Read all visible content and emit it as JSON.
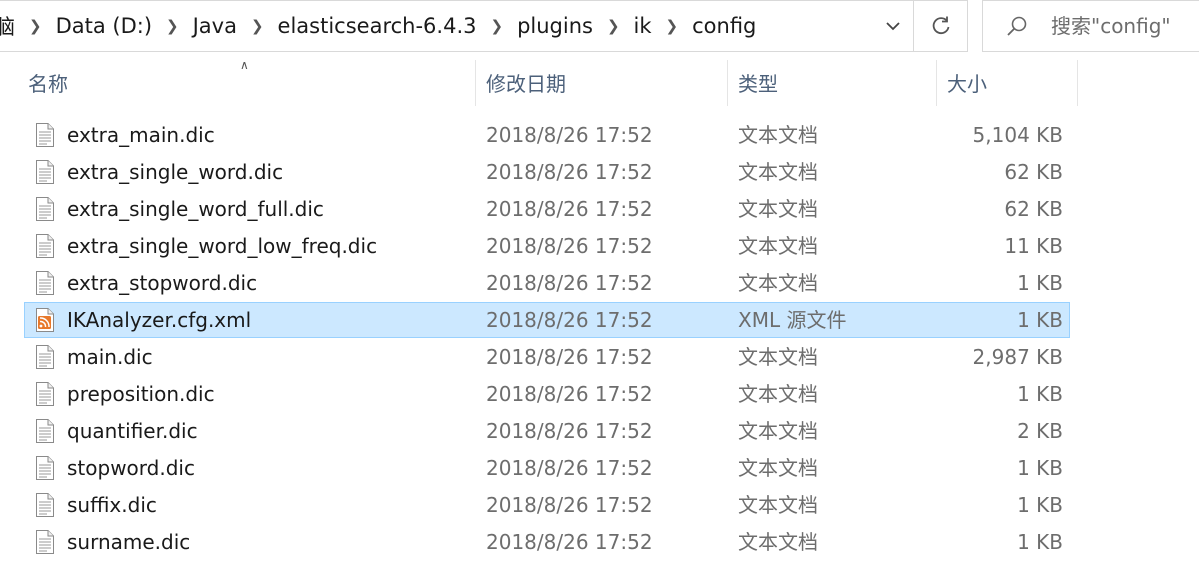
{
  "address": {
    "crumbs": [
      "脑",
      "Data (D:)",
      "Java",
      "elasticsearch-6.4.3",
      "plugins",
      "ik",
      "config"
    ]
  },
  "search": {
    "placeholder": "搜索\"config\""
  },
  "columns": {
    "name": "名称",
    "date": "修改日期",
    "type": "类型",
    "size": "大小"
  },
  "files": [
    {
      "name": "extra_main.dic",
      "date": "2018/8/26 17:52",
      "type": "文本文档",
      "size": "5,104 KB",
      "icon": "text-file-icon",
      "selected": false
    },
    {
      "name": "extra_single_word.dic",
      "date": "2018/8/26 17:52",
      "type": "文本文档",
      "size": "62 KB",
      "icon": "text-file-icon",
      "selected": false
    },
    {
      "name": "extra_single_word_full.dic",
      "date": "2018/8/26 17:52",
      "type": "文本文档",
      "size": "62 KB",
      "icon": "text-file-icon",
      "selected": false
    },
    {
      "name": "extra_single_word_low_freq.dic",
      "date": "2018/8/26 17:52",
      "type": "文本文档",
      "size": "11 KB",
      "icon": "text-file-icon",
      "selected": false
    },
    {
      "name": "extra_stopword.dic",
      "date": "2018/8/26 17:52",
      "type": "文本文档",
      "size": "1 KB",
      "icon": "text-file-icon",
      "selected": false
    },
    {
      "name": "IKAnalyzer.cfg.xml",
      "date": "2018/8/26 17:52",
      "type": "XML 源文件",
      "size": "1 KB",
      "icon": "xml-file-icon",
      "selected": true
    },
    {
      "name": "main.dic",
      "date": "2018/8/26 17:52",
      "type": "文本文档",
      "size": "2,987 KB",
      "icon": "text-file-icon",
      "selected": false
    },
    {
      "name": "preposition.dic",
      "date": "2018/8/26 17:52",
      "type": "文本文档",
      "size": "1 KB",
      "icon": "text-file-icon",
      "selected": false
    },
    {
      "name": "quantifier.dic",
      "date": "2018/8/26 17:52",
      "type": "文本文档",
      "size": "2 KB",
      "icon": "text-file-icon",
      "selected": false
    },
    {
      "name": "stopword.dic",
      "date": "2018/8/26 17:52",
      "type": "文本文档",
      "size": "1 KB",
      "icon": "text-file-icon",
      "selected": false
    },
    {
      "name": "suffix.dic",
      "date": "2018/8/26 17:52",
      "type": "文本文档",
      "size": "1 KB",
      "icon": "text-file-icon",
      "selected": false
    },
    {
      "name": "surname.dic",
      "date": "2018/8/26 17:52",
      "type": "文本文档",
      "size": "1 KB",
      "icon": "text-file-icon",
      "selected": false
    }
  ],
  "colors": {
    "selection_bg": "#cce8ff",
    "selection_border": "#99d1ff",
    "header_text": "#4c607a",
    "xml_icon": "#e8782a"
  }
}
